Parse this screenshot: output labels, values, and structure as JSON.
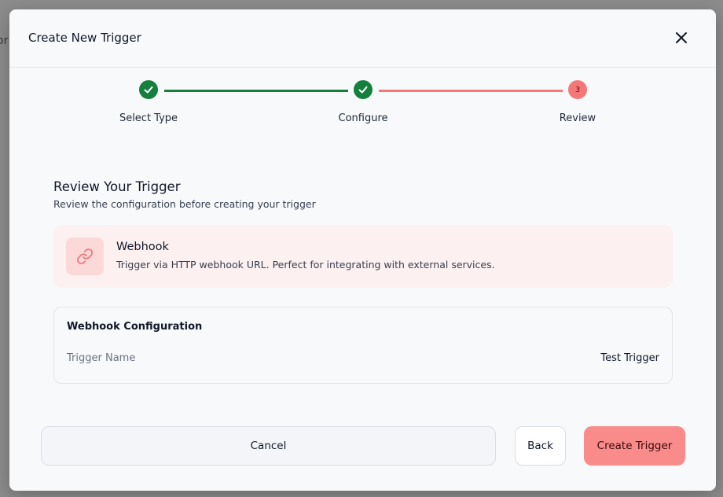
{
  "backdrop": {
    "partial_text": "or"
  },
  "dialog": {
    "title": "Create New Trigger"
  },
  "stepper": {
    "steps": [
      {
        "label": "Select Type",
        "state": "done"
      },
      {
        "label": "Configure",
        "state": "done"
      },
      {
        "label": "Review",
        "state": "active",
        "number": "3"
      }
    ],
    "colors": {
      "done": "#15803d",
      "active": "#f47878"
    }
  },
  "review": {
    "title": "Review Your Trigger",
    "subtitle": "Review the configuration before creating your trigger",
    "type_card": {
      "icon": "link-icon",
      "name": "Webhook",
      "description": "Trigger via HTTP webhook URL. Perfect for integrating with external services."
    },
    "config": {
      "title": "Webhook Configuration",
      "fields": [
        {
          "label": "Trigger Name",
          "value": "Test Trigger"
        }
      ]
    }
  },
  "footer": {
    "cancel_label": "Cancel",
    "back_label": "Back",
    "create_label": "Create Trigger"
  },
  "theme": {
    "accent": "#f98b8b",
    "success": "#15803d"
  }
}
